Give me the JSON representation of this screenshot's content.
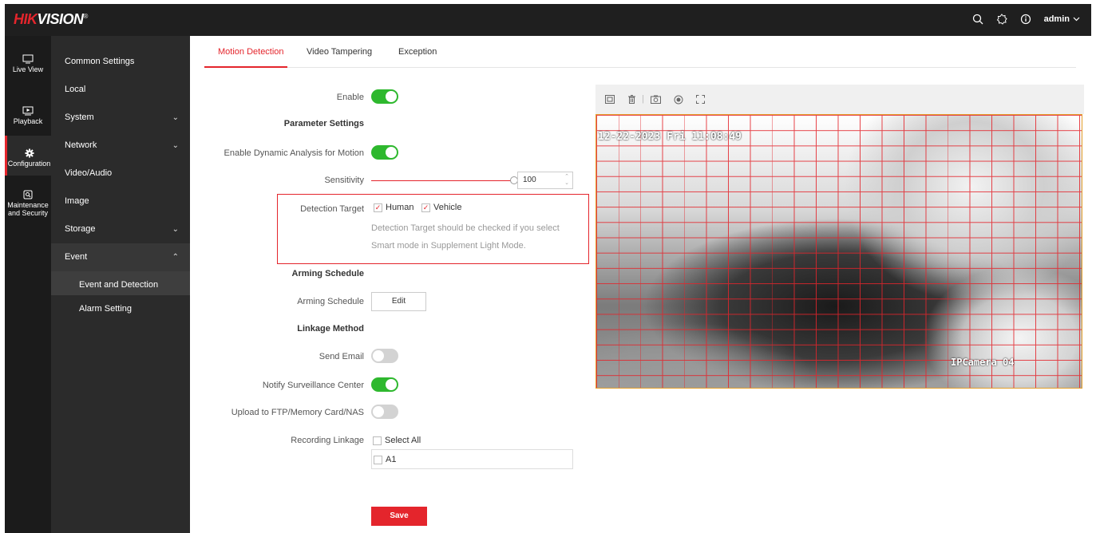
{
  "brand": {
    "logo_red": "HIK",
    "logo_white": "VISION",
    "mark": "®"
  },
  "header": {
    "user": "admin"
  },
  "rail": [
    {
      "label": "Live View"
    },
    {
      "label": "Playback"
    },
    {
      "label": "Configuration"
    },
    {
      "label": "Maintenance and Security"
    }
  ],
  "menu": {
    "common": "Common Settings",
    "local": "Local",
    "system": "System",
    "network": "Network",
    "video_audio": "Video/Audio",
    "image": "Image",
    "storage": "Storage",
    "event": "Event",
    "event_detection": "Event and Detection",
    "alarm_setting": "Alarm Setting"
  },
  "tabs": [
    "Motion Detection",
    "Video Tampering",
    "Exception"
  ],
  "form": {
    "enable": "Enable",
    "parameter_settings": "Parameter Settings",
    "dynamic_analysis": "Enable Dynamic Analysis for Motion",
    "sensitivity": "Sensitivity",
    "sensitivity_value": "100",
    "detection_target": "Detection Target",
    "human": "Human",
    "vehicle": "Vehicle",
    "hint_line1": "Detection Target should be checked if you select",
    "hint_line2": "Smart mode in Supplement Light Mode.",
    "arming_schedule_section": "Arming Schedule",
    "arming_schedule": "Arming Schedule",
    "edit": "Edit",
    "linkage_method": "Linkage Method",
    "send_email": "Send Email",
    "notify_center": "Notify Surveillance Center",
    "upload_ftp": "Upload to FTP/Memory Card/NAS",
    "recording_linkage": "Recording Linkage",
    "select_all": "Select All",
    "a1": "A1",
    "save": "Save"
  },
  "toggles": {
    "enable": true,
    "dynamic_analysis": true,
    "send_email": false,
    "notify_center": true,
    "upload_ftp": false
  },
  "sensitivity_level": 100,
  "video": {
    "timestamp": "12-22-2023 Fri 11:08:49",
    "camera_name": "IPCamera 04"
  },
  "colors": {
    "accent": "#e4252c",
    "toggle_on": "#2eb82e",
    "toggle_off": "#d3d3d3"
  }
}
